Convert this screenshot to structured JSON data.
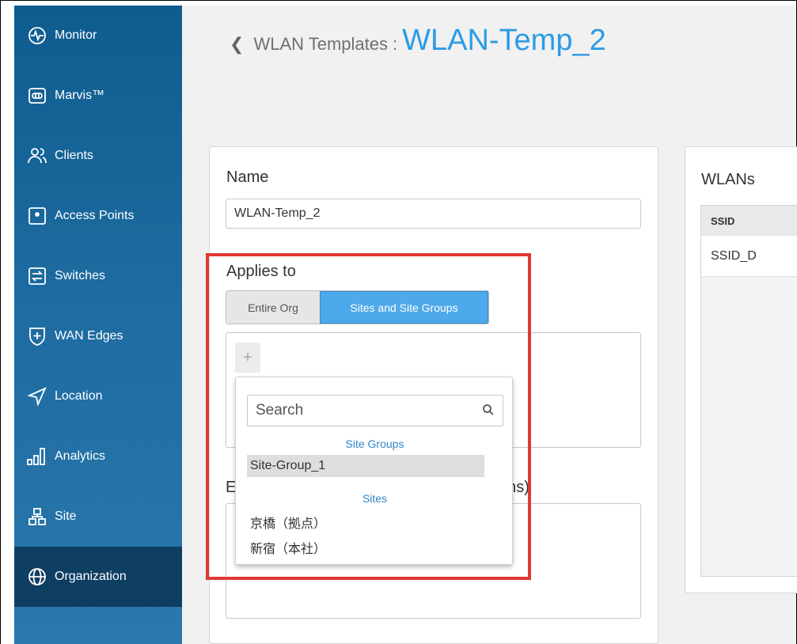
{
  "sidebar": {
    "items": [
      {
        "label": "Monitor",
        "icon": "monitor-icon"
      },
      {
        "label": "Marvis™",
        "icon": "marvis-icon"
      },
      {
        "label": "Clients",
        "icon": "clients-icon"
      },
      {
        "label": "Access Points",
        "icon": "access-point-icon"
      },
      {
        "label": "Switches",
        "icon": "switch-icon"
      },
      {
        "label": "WAN Edges",
        "icon": "wan-edge-icon"
      },
      {
        "label": "Location",
        "icon": "location-icon"
      },
      {
        "label": "Analytics",
        "icon": "analytics-icon"
      },
      {
        "label": "Site",
        "icon": "site-icon"
      },
      {
        "label": "Organization",
        "icon": "globe-icon",
        "active": true
      }
    ]
  },
  "header": {
    "breadcrumb": "WLAN Templates",
    "separator": ":",
    "title": "WLAN-Temp_2"
  },
  "form": {
    "name_label": "Name",
    "name_value": "WLAN-Temp_2",
    "applies_label": "Applies to",
    "applies_options": [
      "Entire Org",
      "Sites and Site Groups"
    ],
    "applies_selected": "Sites and Site Groups",
    "add_symbol": "+",
    "exclusion_label_left": "E",
    "exclusion_label_right": "ons)"
  },
  "dropdown": {
    "search_placeholder": "Search",
    "site_groups_heading": "Site Groups",
    "site_groups": [
      "Site-Group_1"
    ],
    "sites_heading": "Sites",
    "sites": [
      "京橋（拠点）",
      "新宿（本社）"
    ]
  },
  "wlans": {
    "title": "WLANs",
    "columns": [
      "SSID"
    ],
    "rows": [
      [
        "SSID_D"
      ]
    ]
  },
  "colors": {
    "sidebar": "#1d6ba0",
    "sidebar_active": "#0f3e63",
    "accent": "#2c9be5",
    "highlight_box": "#dd3a33"
  }
}
